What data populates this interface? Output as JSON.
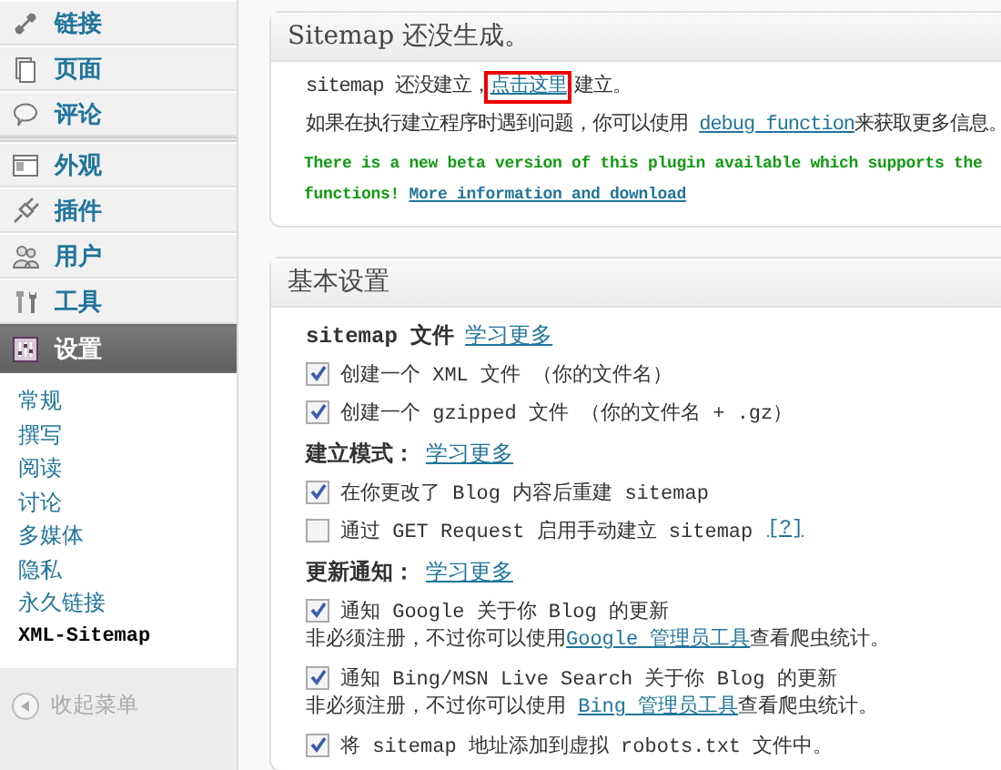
{
  "sidebar": {
    "menu_groups": [
      [
        {
          "label": "链接",
          "selected": false
        },
        {
          "label": "页面",
          "selected": false
        },
        {
          "label": "评论",
          "selected": false
        }
      ],
      [
        {
          "label": "外观",
          "selected": false
        },
        {
          "label": "插件",
          "selected": false
        },
        {
          "label": "用户",
          "selected": false
        },
        {
          "label": "工具",
          "selected": false
        },
        {
          "label": "设置",
          "selected": true,
          "children": [
            {
              "label": "常规",
              "selected": false
            },
            {
              "label": "撰写",
              "selected": false
            },
            {
              "label": "阅读",
              "selected": false
            },
            {
              "label": "讨论",
              "selected": false
            },
            {
              "label": "多媒体",
              "selected": false
            },
            {
              "label": "隐私",
              "selected": false
            },
            {
              "label": "永久链接",
              "selected": false
            },
            {
              "label": "XML-Sitemap",
              "selected": true
            }
          ]
        }
      ]
    ],
    "collapse": "收起菜单"
  },
  "notice_box": {
    "title": "Sitemap 还没生成。",
    "paragraphs": [
      {
        "kind": "plain",
        "lines": [
          [
            {
              "kind": "text",
              "text": "sitemap 还没建立，"
            },
            {
              "kind": "link",
              "text": "点击这里",
              "highlighted": true
            },
            {
              "kind": "text",
              "text": "建立。"
            }
          ]
        ]
      },
      {
        "kind": "plain",
        "lines": [
          [
            {
              "kind": "text",
              "text": "如果在执行建立程序时遇到问题，你可以使用 "
            },
            {
              "kind": "link",
              "text": "debug function"
            },
            {
              "kind": "text",
              "text": "来获取更多信息。"
            }
          ]
        ]
      },
      {
        "kind": "beta",
        "lines": [
          [
            {
              "kind": "text",
              "text": "There is a new beta version of this plugin available which supports the"
            }
          ],
          [
            {
              "kind": "text",
              "text": "functions! "
            },
            {
              "kind": "link",
              "text": "More information and download"
            }
          ]
        ]
      }
    ]
  },
  "settings_box": {
    "title": "基本设置",
    "groups": [
      {
        "heading": "sitemap 文件",
        "link": "学习更多",
        "options": [
          {
            "label": "创建一个 XML 文件 （你的文件名）",
            "checked": true
          },
          {
            "label": "创建一个 gzipped 文件 （你的文件名 + .gz）",
            "checked": true
          }
        ]
      },
      {
        "heading": "建立模式：",
        "link": "学习更多",
        "options": [
          {
            "label": "在你更改了 Blog 内容后重建 sitemap",
            "checked": true
          },
          {
            "label": "通过 GET Request 启用手动建立 sitemap",
            "checked": false,
            "help": "[?]"
          }
        ]
      },
      {
        "heading": "更新通知：",
        "link": "学习更多",
        "options": [
          {
            "label": "通知 Google 关于你 Blog 的更新",
            "checked": true,
            "note": [
              {
                "kind": "text",
                "text": "非必须注册，不过你可以使用"
              },
              {
                "kind": "link",
                "text": "Google 管理员工具"
              },
              {
                "kind": "text",
                "text": "查看爬虫统计。"
              }
            ]
          },
          {
            "label": "通知 Bing/MSN Live Search 关于你 Blog 的更新",
            "checked": true,
            "note": [
              {
                "kind": "text",
                "text": "非必须注册，不过你可以使用 "
              },
              {
                "kind": "link",
                "text": "Bing 管理员工具"
              },
              {
                "kind": "text",
                "text": "查看爬虫统计。"
              }
            ]
          },
          {
            "label": "将 sitemap 地址添加到虚拟 robots.txt 文件中。",
            "checked": true
          }
        ]
      }
    ]
  }
}
